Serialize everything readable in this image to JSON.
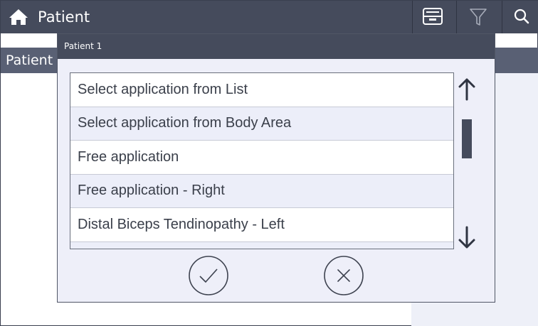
{
  "app": {
    "title": "Patient",
    "icons": {
      "home": "home-icon",
      "archive": "tray-icon",
      "filter": "filter-icon",
      "search": "search-icon"
    }
  },
  "subbar": {
    "label": "Patient"
  },
  "dialog": {
    "title": "Patient 1",
    "items": [
      {
        "label": "Select application from List"
      },
      {
        "label": "Select application from Body Area"
      },
      {
        "label": "Free application"
      },
      {
        "label": "Free application - Right"
      },
      {
        "label": "Distal Biceps Tendinopathy - Left"
      },
      {
        "label": ""
      }
    ],
    "buttons": {
      "confirm": "check-icon",
      "cancel": "close-icon"
    }
  },
  "colors": {
    "header": "#454b5c",
    "panel": "#eeeff9",
    "alt_row": "#eceef9",
    "text": "#3a3f4a"
  }
}
